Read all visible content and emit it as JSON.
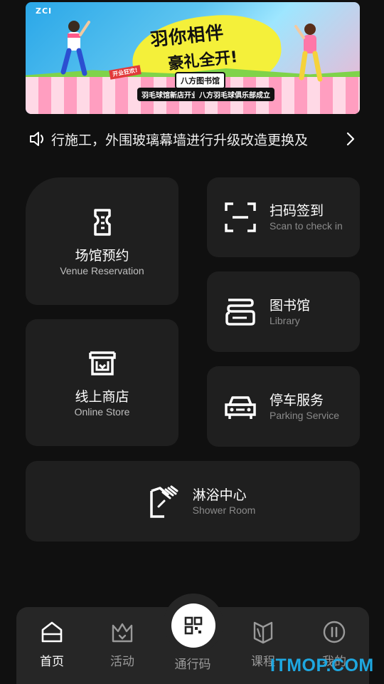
{
  "banner": {
    "logo": "ZCI",
    "title_main": "羽你相伴",
    "title_sub": "豪礼全开!",
    "pill_library": "八方图书馆",
    "pill_store": "羽毛球馆新店开业",
    "pill_club": "八方羽毛球俱乐部成立",
    "tag": "开业狂欢!"
  },
  "notice": {
    "text": "行施工，外围玻璃幕墙进行升级改造更换及"
  },
  "services": {
    "venue": {
      "cn": "场馆预约",
      "en": "Venue Reservation"
    },
    "store": {
      "cn": "线上商店",
      "en": "Online Store"
    },
    "scan": {
      "cn": "扫码签到",
      "en": "Scan to check in"
    },
    "library": {
      "cn": "图书馆",
      "en": "Library"
    },
    "parking": {
      "cn": "停车服务",
      "en": "Parking Service"
    },
    "shower": {
      "cn": "淋浴中心",
      "en": "Shower Room"
    }
  },
  "tabs": {
    "home": "首页",
    "activity": "活动",
    "pass": "通行码",
    "course": "课程",
    "mine": "我的"
  },
  "watermark": "ITMOP.COM",
  "colors": {
    "background": "#101010",
    "card": "#1f1f1f",
    "tabbar": "#262626",
    "watermark": "#1ea7e0"
  }
}
